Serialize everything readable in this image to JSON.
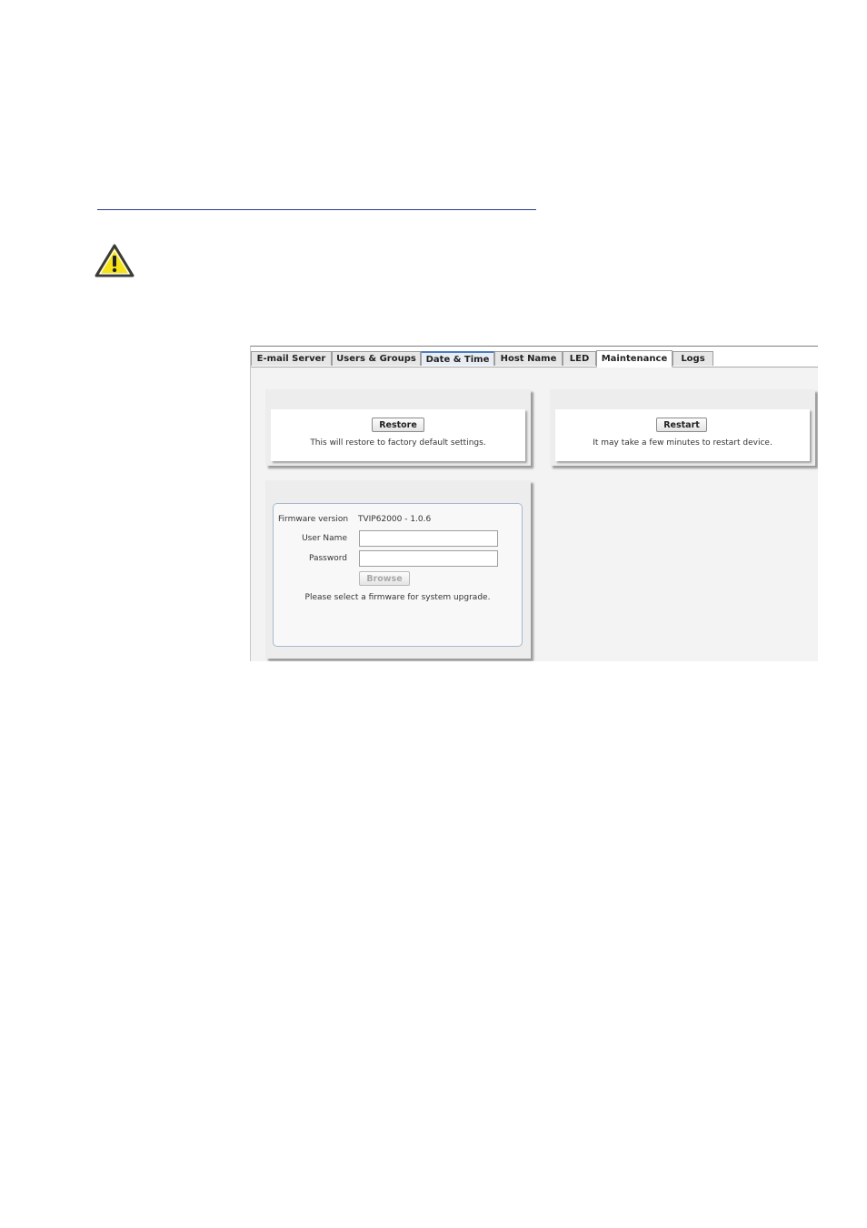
{
  "tabs": [
    {
      "label": "E-mail Server"
    },
    {
      "label": "Users & Groups"
    },
    {
      "label": "Date & Time"
    },
    {
      "label": "Host Name"
    },
    {
      "label": "LED"
    },
    {
      "label": "Maintenance",
      "active": true
    },
    {
      "label": "Logs"
    }
  ],
  "restore": {
    "button_label": "Restore",
    "description": "This will restore to factory default settings."
  },
  "restart": {
    "button_label": "Restart",
    "description": "It may take a few minutes to restart device."
  },
  "firmware": {
    "version_label": "Firmware version",
    "version_value": "TVIP62000 - 1.0.6",
    "username_label": "User Name",
    "username_value": "",
    "password_label": "Password",
    "password_value": "",
    "browse_label": "Browse",
    "hint": "Please select a firmware for system upgrade."
  },
  "icons": {
    "warning": "warning-triangle-icon"
  },
  "colors": {
    "warning_fill": "#f5e31a",
    "tab_accent": "#4a7fc1",
    "fieldset_border": "#a7b8cf"
  }
}
